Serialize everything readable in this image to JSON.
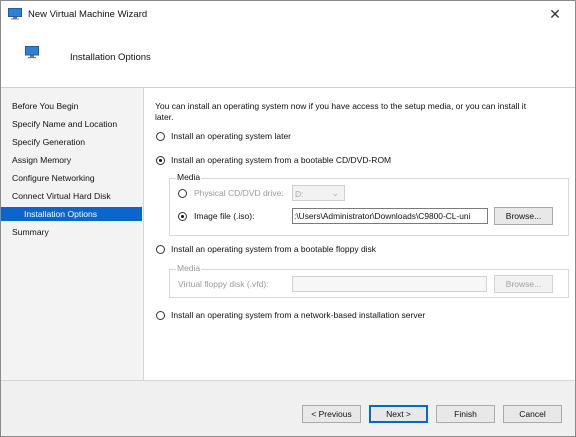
{
  "window": {
    "title": "New Virtual Machine Wizard",
    "close_glyph": "✕",
    "header_title": "Installation Options"
  },
  "icons": {
    "app_icon": "monitor-icon",
    "header_icon": "monitor-icon",
    "close_icon": "close-icon"
  },
  "nav": {
    "items": [
      "Before You Begin",
      "Specify Name and Location",
      "Specify Generation",
      "Assign Memory",
      "Configure Networking",
      "Connect Virtual Hard Disk",
      "Installation Options",
      "Summary"
    ],
    "active_index": 6
  },
  "content": {
    "intro_line1": "You can install an operating system now if you have access to the setup media, or you can install it",
    "intro_line2": "later.",
    "options": {
      "later": "Install an operating system later",
      "cdrom": "Install an operating system from a bootable CD/DVD-ROM",
      "floppy": "Install an operating system from a bootable floppy disk",
      "network": "Install an operating system from a network-based installation server"
    },
    "selected_option": "cdrom",
    "cd_media": {
      "group_title": "Media",
      "physical_label": "Physical CD/DVD drive:",
      "physical_value": "D:",
      "image_label": "Image file (.iso):",
      "image_value": ":\\Users\\Administrator\\Downloads\\C9800-CL-uni",
      "browse_label": "Browse..."
    },
    "floppy_media": {
      "group_title": "Media",
      "vfd_label": "Virtual floppy disk (.vfd):",
      "vfd_value": "",
      "browse_label": "Browse..."
    }
  },
  "footer": {
    "previous": "< Previous",
    "next": "Next >",
    "finish": "Finish",
    "cancel": "Cancel"
  },
  "colors": {
    "accent": "#0a66cc",
    "window_bg": "#f0f0f0"
  }
}
